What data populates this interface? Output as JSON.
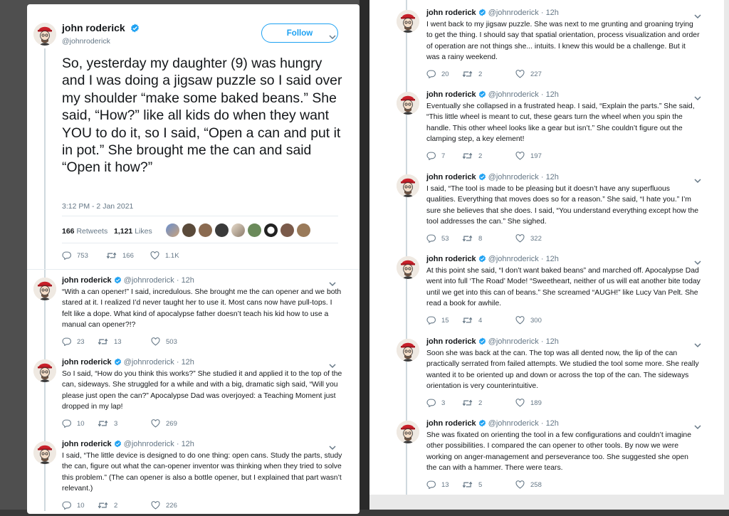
{
  "main_tweet": {
    "name": "john roderick",
    "handle": "@johnroderick",
    "follow_label": "Follow",
    "text": "So, yesterday my daughter (9) was hungry and I was doing a jigsaw puzzle so I said over my shoulder “make some baked beans.” She said, “How?” like all kids do when they want YOU to do it, so I said, “Open a can and put it in pot.” She brought me the can and said “Open it how?”",
    "timestamp": "3:12 PM - 2 Jan 2021",
    "retweets_count": "166",
    "retweets_label": "Retweets",
    "likes_count": "1,121",
    "likes_label": "Likes",
    "replies": "753",
    "retweets": "166",
    "likes": "1.1K"
  },
  "left_replies": [
    {
      "name": "john roderick",
      "handle": "@johnroderick",
      "time": "· 12h",
      "text": "“With a can opener!” I said, incredulous. She brought me the can opener and we both stared at it. I realized I’d never taught her to use it. Most cans now have pull-tops. I felt like a dope. What kind of apocalypse father doesn’t teach his kid how to use a manual can opener?!?",
      "replies": "23",
      "retweets": "13",
      "likes": "503"
    },
    {
      "name": "john roderick",
      "handle": "@johnroderick",
      "time": "· 12h",
      "text": "So I said, “How do you think this works?” She studied it and applied it to the top of the can, sideways. She struggled for a while and with a big, dramatic sigh said, “Will you please just open the can?” Apocalypse Dad was overjoyed: a Teaching Moment just dropped in my lap!",
      "replies": "10",
      "retweets": "3",
      "likes": "269"
    },
    {
      "name": "john roderick",
      "handle": "@johnroderick",
      "time": "· 12h",
      "text": "I said, “The little device is designed to do one thing: open cans. Study the parts, study the can, figure out what the can-opener inventor was thinking when they tried to solve this problem.” (The can opener is also a bottle opener, but I explained that part wasn’t relevant.)",
      "replies": "10",
      "retweets": "2",
      "likes": "226"
    }
  ],
  "right_replies": [
    {
      "name": "john roderick",
      "handle": "@johnroderick",
      "time": "· 12h",
      "text": "I went back to my jigsaw puzzle. She was next to me grunting and groaning trying to get the thing. I should say that spatial orientation, process visualization and order of operation are not things she... intuits. I knew this would be a challenge. But it was a rainy weekend.",
      "replies": "20",
      "retweets": "2",
      "likes": "227"
    },
    {
      "name": "john roderick",
      "handle": "@johnroderick",
      "time": "· 12h",
      "text": "Eventually she collapsed in a frustrated heap. I said, “Explain the parts.” She said, “This little wheel is meant to cut, these gears turn the wheel when you spin the handle. This other wheel looks like a gear but isn’t.” She couldn’t figure out the clamping step, a key element!",
      "replies": "7",
      "retweets": "2",
      "likes": "197"
    },
    {
      "name": "john roderick",
      "handle": "@johnroderick",
      "time": "· 12h",
      "text": "I said, “The tool is made to be pleasing but it doesn’t have any superfluous qualities. Everything that moves does so for a reason.” She said, “I hate you.” I’m sure she believes that she does. I said, “You understand everything except how the tool addresses the can.” She sighed.",
      "replies": "53",
      "retweets": "8",
      "likes": "322"
    },
    {
      "name": "john roderick",
      "handle": "@johnroderick",
      "time": "· 12h",
      "text": "At this point she said, “I don’t want baked beans” and marched off. Apocalypse Dad went into full ‘The Road’ Mode! “Sweetheart, neither of us will eat another bite today until we get into this can of beans.” She screamed “AUGH!” like Lucy Van Pelt. She read a book for awhile.",
      "replies": "15",
      "retweets": "4",
      "likes": "300"
    },
    {
      "name": "john roderick",
      "handle": "@johnroderick",
      "time": "· 12h",
      "text": "Soon she was back at the can. The top was all dented now, the lip of the can practically serrated from failed attempts. We studied the tool some more. She really wanted it to be oriented up and down or across the top of the can. The sideways orientation is very counterintuitive.",
      "replies": "3",
      "retweets": "2",
      "likes": "189"
    },
    {
      "name": "john roderick",
      "handle": "@johnroderick",
      "time": "· 12h",
      "text": "She was fixated on orienting the tool in a few configurations and couldn’t imagine other possibilities. I compared the can opener to other tools. By now we were working on anger-management and perseverance too. She suggested she open the can with a hammer. There were tears.",
      "replies": "13",
      "retweets": "5",
      "likes": "258"
    }
  ],
  "icons": {
    "reply": "reply-icon",
    "retweet": "retweet-icon",
    "like": "heart-icon",
    "verified": "verified-badge-icon",
    "caret": "chevron-down-icon"
  },
  "colors": {
    "accent": "#1da1f2",
    "thread_line": "#cfd9de",
    "secondary_text": "#657786",
    "primary_text": "#14171a"
  }
}
